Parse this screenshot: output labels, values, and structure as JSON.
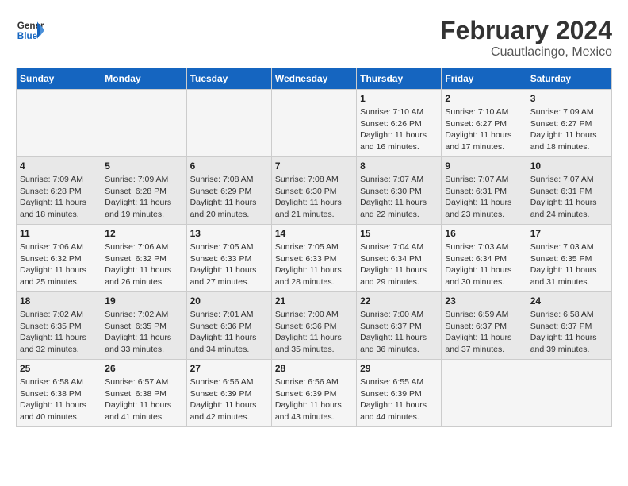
{
  "header": {
    "logo_line1": "General",
    "logo_line2": "Blue",
    "main_title": "February 2024",
    "subtitle": "Cuautlacingo, Mexico"
  },
  "days_of_week": [
    "Sunday",
    "Monday",
    "Tuesday",
    "Wednesday",
    "Thursday",
    "Friday",
    "Saturday"
  ],
  "weeks": [
    [
      {
        "num": "",
        "info": ""
      },
      {
        "num": "",
        "info": ""
      },
      {
        "num": "",
        "info": ""
      },
      {
        "num": "",
        "info": ""
      },
      {
        "num": "1",
        "info": "Sunrise: 7:10 AM\nSunset: 6:26 PM\nDaylight: 11 hours\nand 16 minutes."
      },
      {
        "num": "2",
        "info": "Sunrise: 7:10 AM\nSunset: 6:27 PM\nDaylight: 11 hours\nand 17 minutes."
      },
      {
        "num": "3",
        "info": "Sunrise: 7:09 AM\nSunset: 6:27 PM\nDaylight: 11 hours\nand 18 minutes."
      }
    ],
    [
      {
        "num": "4",
        "info": "Sunrise: 7:09 AM\nSunset: 6:28 PM\nDaylight: 11 hours\nand 18 minutes."
      },
      {
        "num": "5",
        "info": "Sunrise: 7:09 AM\nSunset: 6:28 PM\nDaylight: 11 hours\nand 19 minutes."
      },
      {
        "num": "6",
        "info": "Sunrise: 7:08 AM\nSunset: 6:29 PM\nDaylight: 11 hours\nand 20 minutes."
      },
      {
        "num": "7",
        "info": "Sunrise: 7:08 AM\nSunset: 6:30 PM\nDaylight: 11 hours\nand 21 minutes."
      },
      {
        "num": "8",
        "info": "Sunrise: 7:07 AM\nSunset: 6:30 PM\nDaylight: 11 hours\nand 22 minutes."
      },
      {
        "num": "9",
        "info": "Sunrise: 7:07 AM\nSunset: 6:31 PM\nDaylight: 11 hours\nand 23 minutes."
      },
      {
        "num": "10",
        "info": "Sunrise: 7:07 AM\nSunset: 6:31 PM\nDaylight: 11 hours\nand 24 minutes."
      }
    ],
    [
      {
        "num": "11",
        "info": "Sunrise: 7:06 AM\nSunset: 6:32 PM\nDaylight: 11 hours\nand 25 minutes."
      },
      {
        "num": "12",
        "info": "Sunrise: 7:06 AM\nSunset: 6:32 PM\nDaylight: 11 hours\nand 26 minutes."
      },
      {
        "num": "13",
        "info": "Sunrise: 7:05 AM\nSunset: 6:33 PM\nDaylight: 11 hours\nand 27 minutes."
      },
      {
        "num": "14",
        "info": "Sunrise: 7:05 AM\nSunset: 6:33 PM\nDaylight: 11 hours\nand 28 minutes."
      },
      {
        "num": "15",
        "info": "Sunrise: 7:04 AM\nSunset: 6:34 PM\nDaylight: 11 hours\nand 29 minutes."
      },
      {
        "num": "16",
        "info": "Sunrise: 7:03 AM\nSunset: 6:34 PM\nDaylight: 11 hours\nand 30 minutes."
      },
      {
        "num": "17",
        "info": "Sunrise: 7:03 AM\nSunset: 6:35 PM\nDaylight: 11 hours\nand 31 minutes."
      }
    ],
    [
      {
        "num": "18",
        "info": "Sunrise: 7:02 AM\nSunset: 6:35 PM\nDaylight: 11 hours\nand 32 minutes."
      },
      {
        "num": "19",
        "info": "Sunrise: 7:02 AM\nSunset: 6:35 PM\nDaylight: 11 hours\nand 33 minutes."
      },
      {
        "num": "20",
        "info": "Sunrise: 7:01 AM\nSunset: 6:36 PM\nDaylight: 11 hours\nand 34 minutes."
      },
      {
        "num": "21",
        "info": "Sunrise: 7:00 AM\nSunset: 6:36 PM\nDaylight: 11 hours\nand 35 minutes."
      },
      {
        "num": "22",
        "info": "Sunrise: 7:00 AM\nSunset: 6:37 PM\nDaylight: 11 hours\nand 36 minutes."
      },
      {
        "num": "23",
        "info": "Sunrise: 6:59 AM\nSunset: 6:37 PM\nDaylight: 11 hours\nand 37 minutes."
      },
      {
        "num": "24",
        "info": "Sunrise: 6:58 AM\nSunset: 6:37 PM\nDaylight: 11 hours\nand 39 minutes."
      }
    ],
    [
      {
        "num": "25",
        "info": "Sunrise: 6:58 AM\nSunset: 6:38 PM\nDaylight: 11 hours\nand 40 minutes."
      },
      {
        "num": "26",
        "info": "Sunrise: 6:57 AM\nSunset: 6:38 PM\nDaylight: 11 hours\nand 41 minutes."
      },
      {
        "num": "27",
        "info": "Sunrise: 6:56 AM\nSunset: 6:39 PM\nDaylight: 11 hours\nand 42 minutes."
      },
      {
        "num": "28",
        "info": "Sunrise: 6:56 AM\nSunset: 6:39 PM\nDaylight: 11 hours\nand 43 minutes."
      },
      {
        "num": "29",
        "info": "Sunrise: 6:55 AM\nSunset: 6:39 PM\nDaylight: 11 hours\nand 44 minutes."
      },
      {
        "num": "",
        "info": ""
      },
      {
        "num": "",
        "info": ""
      }
    ]
  ]
}
